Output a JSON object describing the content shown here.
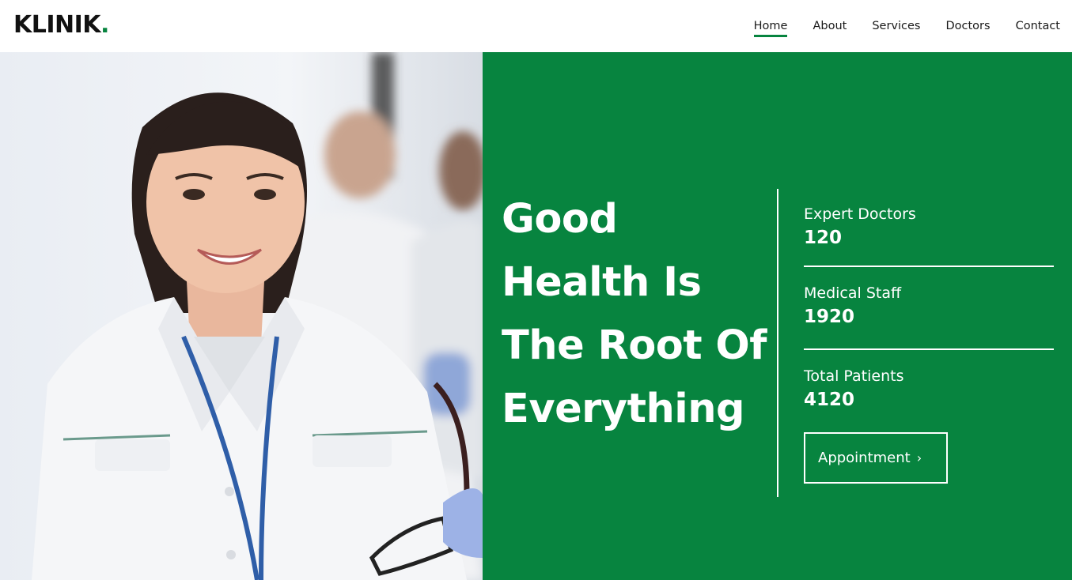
{
  "header": {
    "logo_text": "KLINIK",
    "logo_dot": ".",
    "nav": [
      {
        "label": "Home",
        "active": true
      },
      {
        "label": "About",
        "active": false
      },
      {
        "label": "Services",
        "active": false
      },
      {
        "label": "Doctors",
        "active": false
      },
      {
        "label": "Contact",
        "active": false
      }
    ]
  },
  "hero": {
    "headline": [
      "Good",
      "Health Is",
      "The Root Of",
      "Everything"
    ],
    "stats": [
      {
        "label": "Expert Doctors",
        "value": "120"
      },
      {
        "label": "Medical Staff",
        "value": "1920"
      },
      {
        "label": "Total Patients",
        "value": "4120"
      }
    ],
    "cta_label": "Appointment",
    "cta_icon": "chevron-right-icon"
  },
  "colors": {
    "brand_green": "#07843f",
    "text_dark": "#111111",
    "white": "#ffffff"
  }
}
